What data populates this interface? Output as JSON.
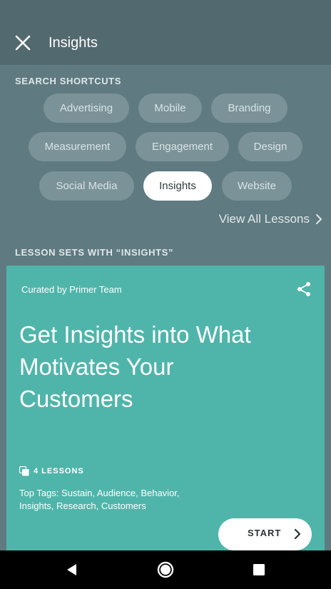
{
  "header": {
    "title": "Insights"
  },
  "search_shortcuts": {
    "label": "SEARCH SHORTCUTS",
    "chips": [
      "Advertising",
      "Mobile",
      "Branding",
      "Measurement",
      "Engagement",
      "Design",
      "Social Media",
      "Insights",
      "Website"
    ],
    "selected": "Insights",
    "view_all": "View All Lessons"
  },
  "lesson_sets": {
    "label": "LESSON SETS WITH “INSIGHTS”",
    "card": {
      "curated_by": "Curated by Primer Team",
      "title": "Get Insights into What Motivates Your Customers",
      "lessons_count": "4 LESSONS",
      "tags": "Top Tags: Sustain, Audience, Behavior, Insights, Research, Customers",
      "start_label": "START",
      "color": "#4fb5aa"
    }
  },
  "icons": {
    "close": "close-icon",
    "share": "share-icon",
    "lessons": "stack-icon",
    "chevron": "chevron-right-icon",
    "back": "back-icon",
    "home": "home-icon",
    "recents": "recents-icon"
  }
}
